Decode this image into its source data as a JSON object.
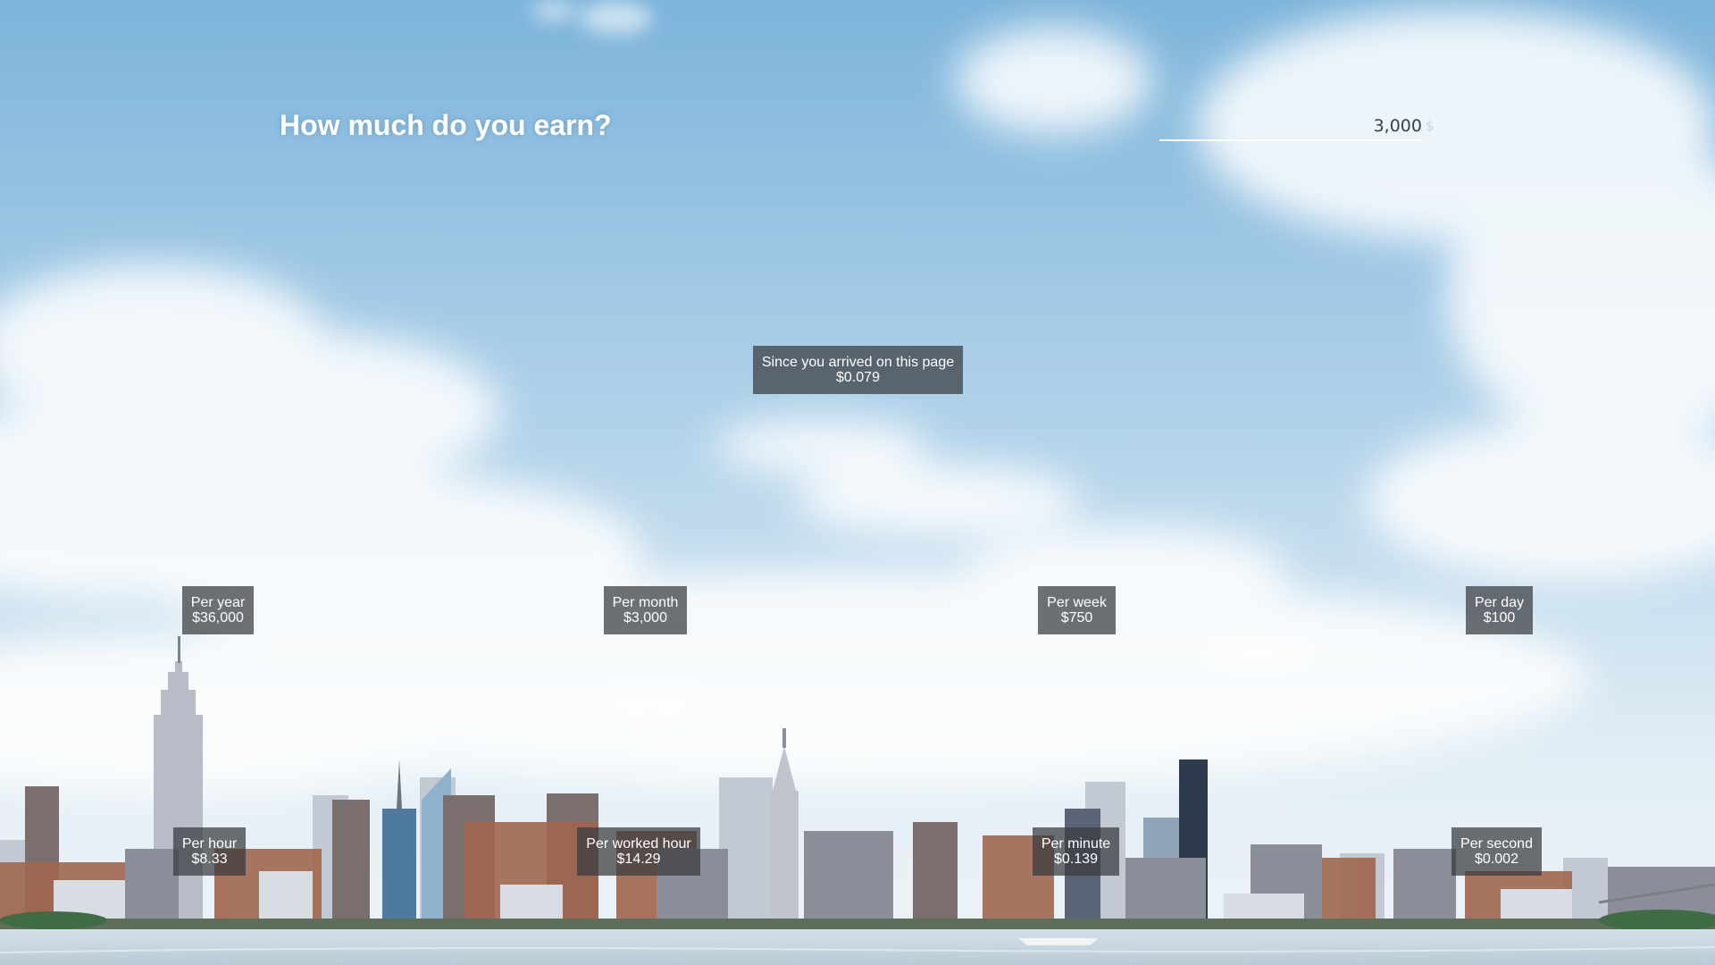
{
  "page": {
    "title": "How much do you earn?"
  },
  "salary": {
    "value": "3,000",
    "currency_symbol": "$"
  },
  "since_arrival": {
    "label": "Since you arrived on this page",
    "value": "$0.079"
  },
  "rates": {
    "per_year": {
      "label": "Per year",
      "value": "$36,000"
    },
    "per_month": {
      "label": "Per month",
      "value": "$3,000"
    },
    "per_week": {
      "label": "Per week",
      "value": "$750"
    },
    "per_day": {
      "label": "Per day",
      "value": "$100"
    },
    "per_hour": {
      "label": "Per hour",
      "value": "$8.33"
    },
    "per_worked_hour": {
      "label": "Per worked hour",
      "value": "$14.29"
    },
    "per_minute": {
      "label": "Per minute",
      "value": "$0.139"
    },
    "per_second": {
      "label": "Per second",
      "value": "$0.002"
    }
  },
  "colors": {
    "sky_top": "#7fb6dd",
    "sky_bottom": "#e8f1f7",
    "label_bg": "#383a3e",
    "title": "#ffffff",
    "water": "#c9d8e2"
  }
}
